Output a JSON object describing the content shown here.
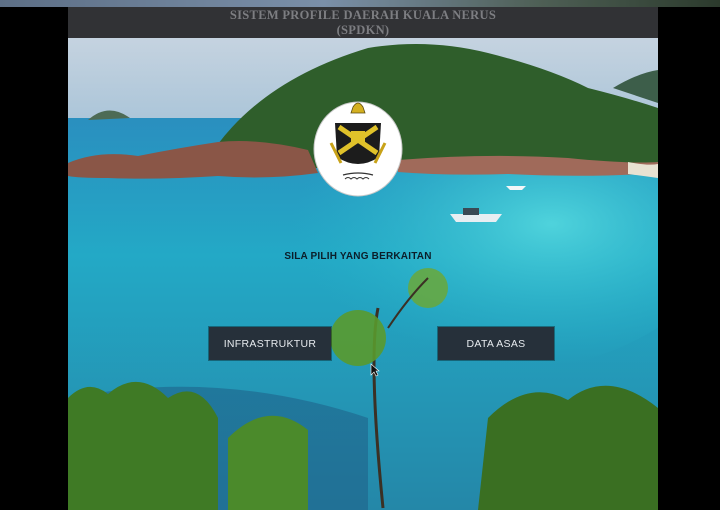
{
  "header": {
    "title_line1": "SISTEM PROFILE DAERAH KUALA NERUS",
    "title_line2": "(SPDKN)"
  },
  "emblem": {
    "icon": "terengganu-crest-icon"
  },
  "main": {
    "prompt": "SILA PILIH YANG BERKAITAN",
    "buttons": {
      "infrastruktur": "INFRASTRUKTUR",
      "data_asas": "DATA ASAS"
    }
  },
  "colors": {
    "header_bg": "#313235",
    "header_text": "#7d7e82",
    "button_bg": "#26303a",
    "button_text": "#e6eaee",
    "sea": "#23a9c6"
  }
}
